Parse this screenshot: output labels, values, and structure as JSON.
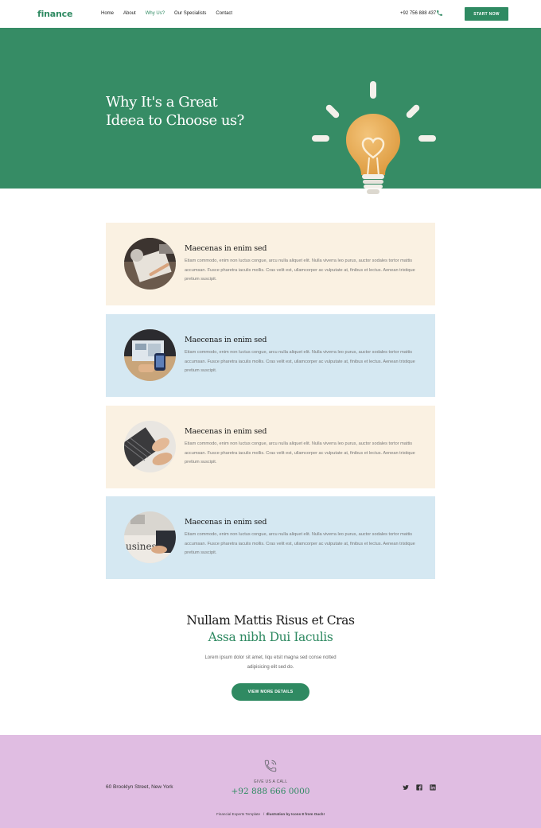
{
  "nav": {
    "logo": "finance",
    "menu": [
      "Home",
      "About",
      "Why Us?",
      "Our Specialists",
      "Contact"
    ],
    "phone": "+92 756 888 437",
    "start_button": "START NOW"
  },
  "hero": {
    "title_line1": "Why It's a Great",
    "title_line2": "Ideea to Choose us?"
  },
  "cards": [
    {
      "title": "Maecenas in enim sed",
      "text": "Etiam commodo, enim non luctus congue, arcu nulla aliquet elit. Nulla viverra leo purus, auctor sodales tortor mattis accumsan. Fusce pharetra iaculis mollis. Cras velit est, ullamcorper ac vulputate at, finibus et lectus. Aenean tristique pretium suscipit."
    },
    {
      "title": "Maecenas in enim sed",
      "text": "Etiam commodo, enim non luctus congue, arcu nulla aliquet elit. Nulla viverra leo purus, auctor sodales tortor mattis accumsan. Fusce pharetra iaculis mollis. Cras velit est, ullamcorper ac vulputate at, finibus et lectus. Aenean tristique pretium suscipit."
    },
    {
      "title": "Maecenas in enim sed",
      "text": "Etiam commodo, enim non luctus congue, arcu nulla aliquet elit. Nulla viverra leo purus, auctor sodales tortor mattis accumsan. Fusce pharetra iaculis mollis. Cras velit est, ullamcorper ac vulputate at, finibus et lectus. Aenean tristique pretium suscipit."
    },
    {
      "title": "Maecenas in enim sed",
      "text": "Etiam commodo, enim non luctus congue, arcu nulla aliquet elit. Nulla viverra leo purus, auctor sodales tortor mattis accumsan. Fusce pharetra iaculis mollis. Cras velit est, ullamcorper ac vulputate at, finibus et lectus. Aenean tristique pretium suscipit."
    }
  ],
  "cta": {
    "title_line1": "Nullam Mattis Risus et Cras",
    "title_line2": "Assa nibh Dui Iaculis",
    "text": "Lorem ipsum dolor sit amet, liqu etsit magna sed conse notted adipisicing elit sed do.",
    "button": "VIEW MORE DETAILS"
  },
  "footer": {
    "address": "60 Brooklyn Street, New York",
    "give_call": "GIVE US A CALL",
    "phone": "+92 888 666 0000",
    "copyright_left": "Financial Experts Template",
    "copyright_right": "Illustration by Icons 8 from Ouch!"
  },
  "colors": {
    "brand_green": "#2f8a62",
    "hero_bg": "#368c65",
    "card_cream": "#faf1e2",
    "card_blue": "#d5e8f2",
    "footer_bg": "#e0bde2"
  },
  "icons": [
    "phone-icon",
    "call-icon",
    "twitter-icon",
    "facebook-icon",
    "linkedin-icon",
    "lightbulb-illustration"
  ]
}
